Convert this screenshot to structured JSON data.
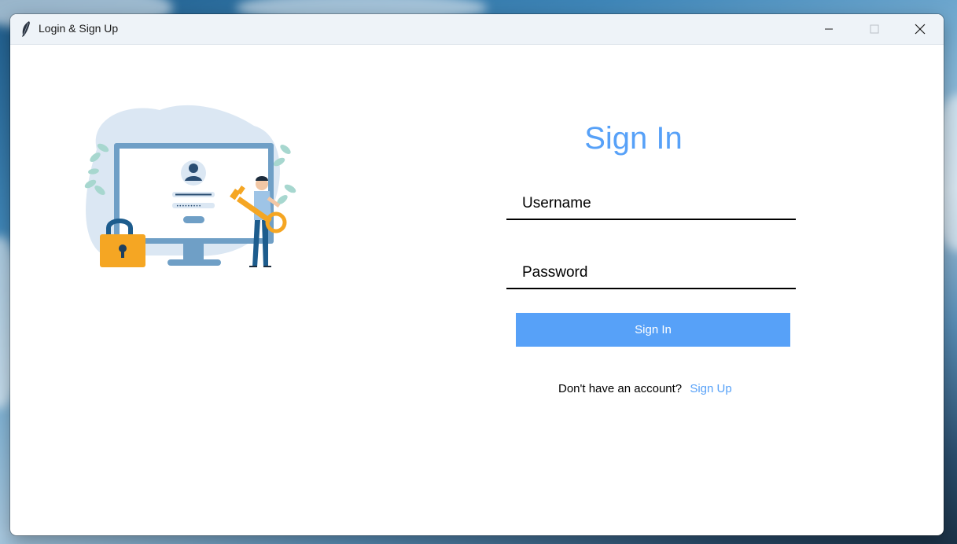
{
  "window": {
    "title": "Login & Sign Up",
    "controls": {
      "minimize": "minimize-icon",
      "maximize": "maximize-icon",
      "close": "close-icon"
    }
  },
  "form": {
    "title": "Sign In",
    "username_placeholder": "Username",
    "password_placeholder": "Password",
    "submit_label": "Sign In",
    "signup_prompt": "Don't have an account?",
    "signup_link": "Sign Up"
  },
  "colors": {
    "accent": "#57a1f8",
    "button_text": "#ffffff",
    "underline": "#000000"
  },
  "illustration": {
    "icon": "login-illustration",
    "password_dots": "•••••••••"
  }
}
